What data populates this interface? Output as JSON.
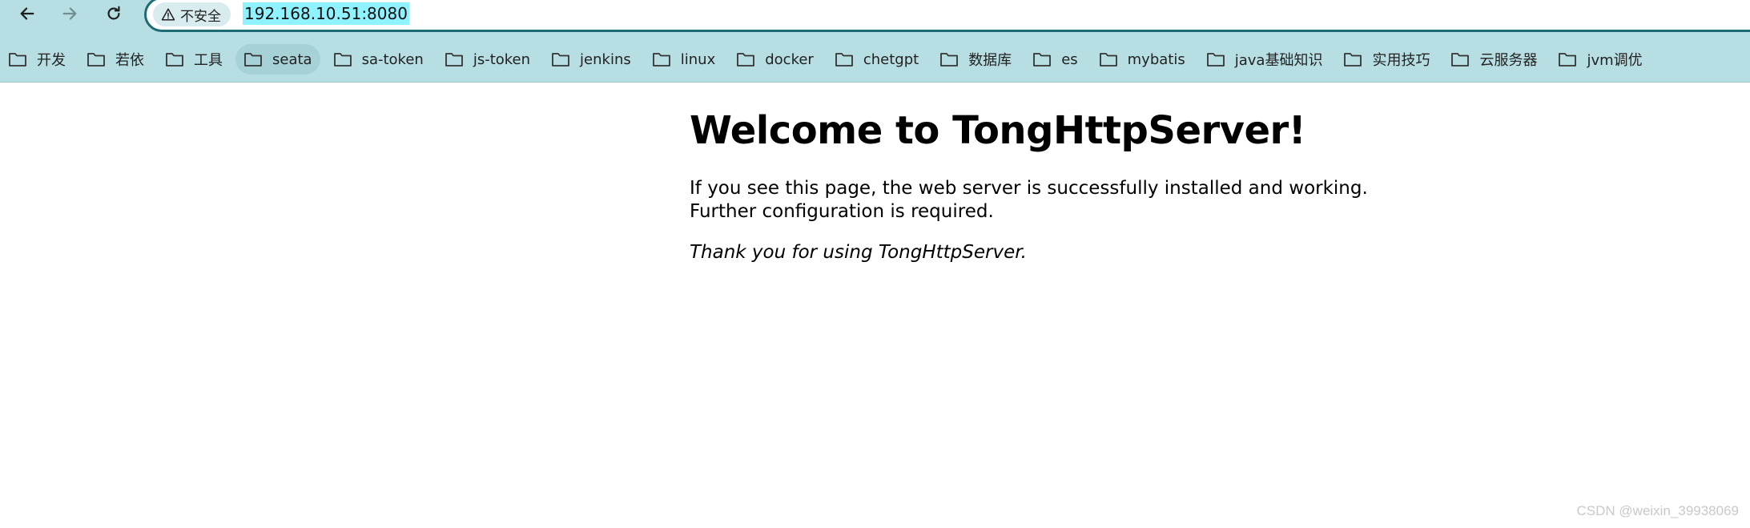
{
  "browser": {
    "security_label": "不安全",
    "url": "192.168.10.51:8080",
    "bookmarks": [
      {
        "label": "开发"
      },
      {
        "label": "若依"
      },
      {
        "label": "工具"
      },
      {
        "label": "seata"
      },
      {
        "label": "sa-token"
      },
      {
        "label": "js-token"
      },
      {
        "label": "jenkins"
      },
      {
        "label": "linux"
      },
      {
        "label": "docker"
      },
      {
        "label": "chetgpt"
      },
      {
        "label": "数据库"
      },
      {
        "label": "es"
      },
      {
        "label": "mybatis"
      },
      {
        "label": "java基础知识"
      },
      {
        "label": "实用技巧"
      },
      {
        "label": "云服务器"
      },
      {
        "label": "jvm调优"
      }
    ],
    "colors": {
      "toolbar_bg": "#b7dfe3",
      "address_border": "#1e6b73",
      "url_highlight": "#8ef2ff"
    }
  },
  "page": {
    "heading": "Welcome to TongHttpServer!",
    "paragraph": "If you see this page, the web server is successfully installed and working. Further configuration is required.",
    "thanks": "Thank you for using TongHttpServer."
  },
  "watermark": "CSDN @weixin_39938069"
}
